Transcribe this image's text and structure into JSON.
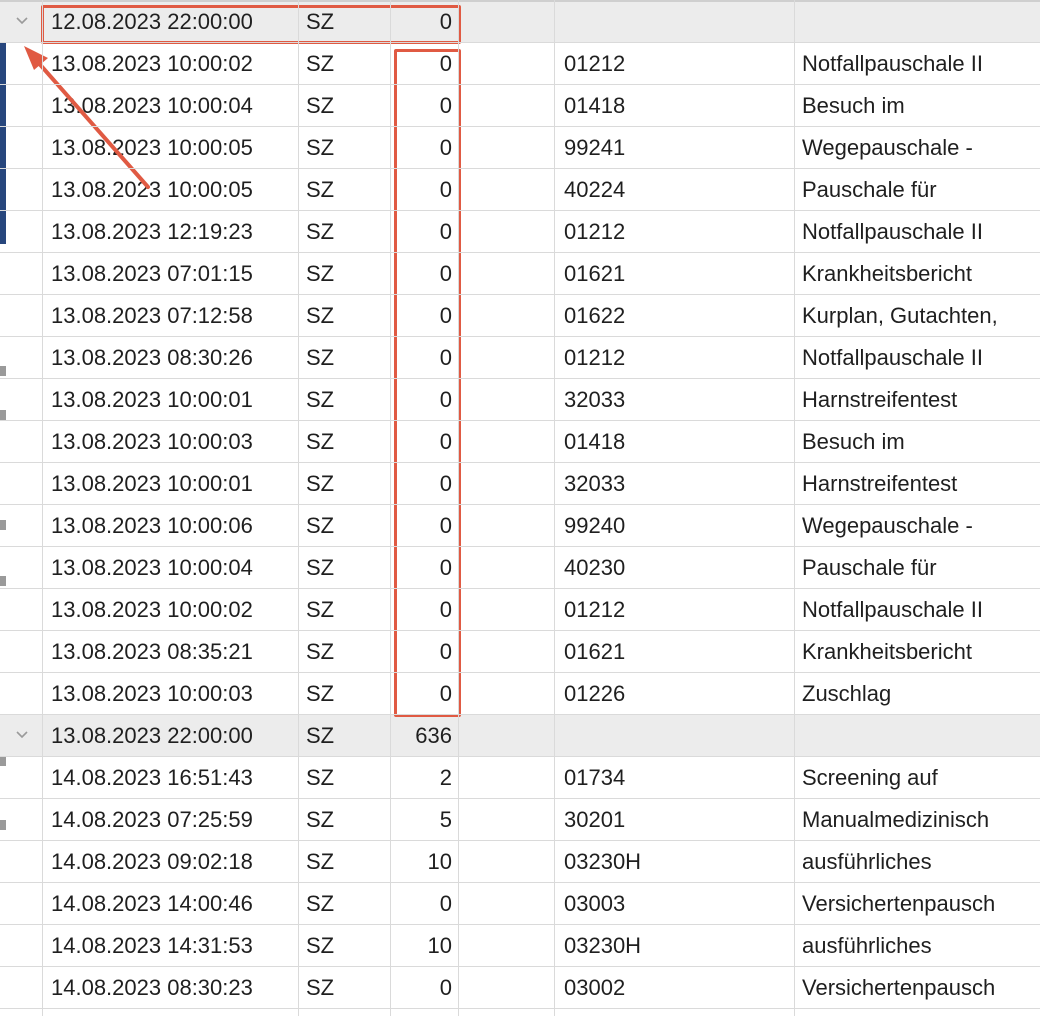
{
  "colors": {
    "highlight": "#e05a43",
    "group_row_bg": "#ececec",
    "grid_line": "#dadada"
  },
  "icons": {
    "expand": "chevron-down-icon"
  },
  "rows": [
    {
      "group": true,
      "time": "12.08.2023 22:00:00",
      "type": "SZ",
      "value": "0",
      "code": "",
      "desc": ""
    },
    {
      "group": false,
      "time": "13.08.2023 10:00:02",
      "type": "SZ",
      "value": "0",
      "code": "01212",
      "desc": "Notfallpauschale II"
    },
    {
      "group": false,
      "time": "13.08.2023 10:00:04",
      "type": "SZ",
      "value": "0",
      "code": "01418",
      "desc": "Besuch im"
    },
    {
      "group": false,
      "time": "13.08.2023 10:00:05",
      "type": "SZ",
      "value": "0",
      "code": "99241",
      "desc": "Wegepauschale -"
    },
    {
      "group": false,
      "time": "13.08.2023 10:00:05",
      "type": "SZ",
      "value": "0",
      "code": "40224",
      "desc": "Pauschale für"
    },
    {
      "group": false,
      "time": "13.08.2023 12:19:23",
      "type": "SZ",
      "value": "0",
      "code": "01212",
      "desc": "Notfallpauschale II"
    },
    {
      "group": false,
      "time": "13.08.2023 07:01:15",
      "type": "SZ",
      "value": "0",
      "code": "01621",
      "desc": "Krankheitsbericht"
    },
    {
      "group": false,
      "time": "13.08.2023 07:12:58",
      "type": "SZ",
      "value": "0",
      "code": "01622",
      "desc": "Kurplan, Gutachten,"
    },
    {
      "group": false,
      "time": "13.08.2023 08:30:26",
      "type": "SZ",
      "value": "0",
      "code": "01212",
      "desc": "Notfallpauschale II"
    },
    {
      "group": false,
      "time": "13.08.2023 10:00:01",
      "type": "SZ",
      "value": "0",
      "code": "32033",
      "desc": "Harnstreifentest"
    },
    {
      "group": false,
      "time": "13.08.2023 10:00:03",
      "type": "SZ",
      "value": "0",
      "code": "01418",
      "desc": "Besuch im"
    },
    {
      "group": false,
      "time": "13.08.2023 10:00:01",
      "type": "SZ",
      "value": "0",
      "code": "32033",
      "desc": "Harnstreifentest"
    },
    {
      "group": false,
      "time": "13.08.2023 10:00:06",
      "type": "SZ",
      "value": "0",
      "code": "99240",
      "desc": "Wegepauschale -"
    },
    {
      "group": false,
      "time": "13.08.2023 10:00:04",
      "type": "SZ",
      "value": "0",
      "code": "40230",
      "desc": "Pauschale für"
    },
    {
      "group": false,
      "time": "13.08.2023 10:00:02",
      "type": "SZ",
      "value": "0",
      "code": "01212",
      "desc": "Notfallpauschale II"
    },
    {
      "group": false,
      "time": "13.08.2023 08:35:21",
      "type": "SZ",
      "value": "0",
      "code": "01621",
      "desc": "Krankheitsbericht"
    },
    {
      "group": false,
      "time": "13.08.2023 10:00:03",
      "type": "SZ",
      "value": "0",
      "code": "01226",
      "desc": "Zuschlag"
    },
    {
      "group": true,
      "time": "13.08.2023 22:00:00",
      "type": "SZ",
      "value": "636",
      "code": "",
      "desc": ""
    },
    {
      "group": false,
      "time": "14.08.2023 16:51:43",
      "type": "SZ",
      "value": "2",
      "code": "01734",
      "desc": "Screening auf"
    },
    {
      "group": false,
      "time": "14.08.2023 07:25:59",
      "type": "SZ",
      "value": "5",
      "code": "30201",
      "desc": "Manualmedizinisch"
    },
    {
      "group": false,
      "time": "14.08.2023 09:02:18",
      "type": "SZ",
      "value": "10",
      "code": "03230H",
      "desc": "ausführliches"
    },
    {
      "group": false,
      "time": "14.08.2023 14:00:46",
      "type": "SZ",
      "value": "0",
      "code": "03003",
      "desc": "Versichertenpausch"
    },
    {
      "group": false,
      "time": "14.08.2023 14:31:53",
      "type": "SZ",
      "value": "10",
      "code": "03230H",
      "desc": "ausführliches"
    },
    {
      "group": false,
      "time": "14.08.2023 08:30:23",
      "type": "SZ",
      "value": "0",
      "code": "03002",
      "desc": "Versichertenpausch"
    }
  ]
}
